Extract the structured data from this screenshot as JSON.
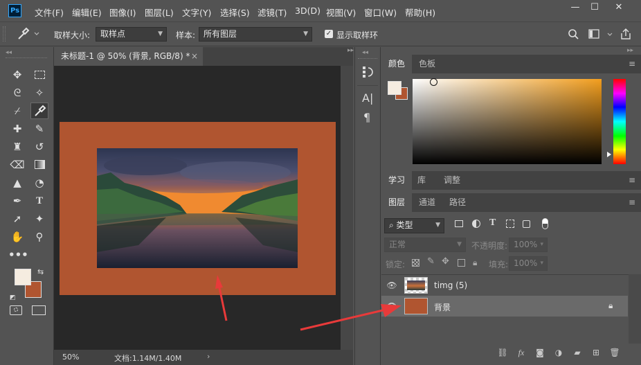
{
  "app": {
    "logo": "Ps"
  },
  "menubar": {
    "items": [
      "文件(F)",
      "编辑(E)",
      "图像(I)",
      "图层(L)",
      "文字(Y)",
      "选择(S)",
      "滤镜(T)",
      "3D(D)",
      "视图(V)",
      "窗口(W)",
      "帮助(H)"
    ],
    "window_controls": [
      "minimize",
      "maximize",
      "close"
    ]
  },
  "options": {
    "tool_icon": "eyedropper-icon",
    "sample_size_label": "取样大小:",
    "sample_size_value": "取样点",
    "sample_label": "样本:",
    "sample_value": "所有图层",
    "show_ring_label": "显示取样环",
    "show_ring_checked": true
  },
  "document": {
    "tab_title": "未标题-1 @ 50% (背景, RGB/8) *",
    "tab_close": "×",
    "canvas_color": "#b05530",
    "status": {
      "zoom": "50%",
      "doc_info": "文档:1.14M/1.40M"
    }
  },
  "tools": [
    "move-icon",
    "marquee-icon",
    "lasso-icon",
    "magic-wand-icon",
    "crop-icon",
    "eyedropper-icon",
    "healing-brush-icon",
    "brush-icon",
    "clone-stamp-icon",
    "history-brush-icon",
    "eraser-icon",
    "gradient-icon",
    "blur-icon",
    "dodge-icon",
    "pen-icon",
    "type-icon",
    "path-select-icon",
    "shape-icon",
    "hand-icon",
    "zoom-icon",
    "more-icon"
  ],
  "colors": {
    "foreground": "#f5ece0",
    "background": "#b05530",
    "accent_red": "#e83a3a"
  },
  "color_panel": {
    "tabs": [
      "颜色",
      "色板"
    ],
    "active": 0
  },
  "learn_panel": {
    "tabs": [
      "学习",
      "库",
      "调整"
    ],
    "active": 0
  },
  "layers_panel": {
    "tabs": [
      "图层",
      "通道",
      "路径"
    ],
    "active": 0,
    "filter_kind": "类型",
    "blend_mode": "正常",
    "opacity_label": "不透明度:",
    "opacity_value": "100%",
    "lock_label": "锁定:",
    "fill_label": "填充:",
    "fill_value": "100%",
    "layers": [
      {
        "name": "timg (5)",
        "visible": true,
        "selected": false
      },
      {
        "name": "背景",
        "visible": true,
        "selected": true,
        "locked": true
      }
    ]
  }
}
